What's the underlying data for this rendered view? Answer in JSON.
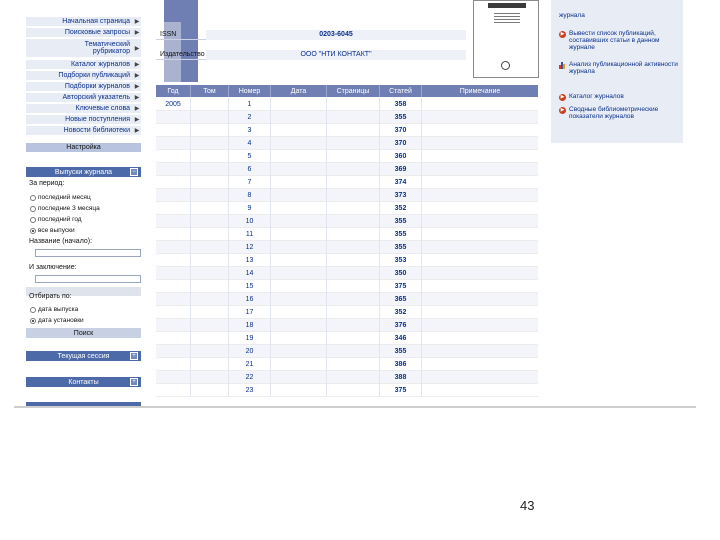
{
  "sidebar": {
    "nav": [
      {
        "label": "Начальная страница"
      },
      {
        "label": "Поисковые запросы"
      },
      {
        "label": "Тематический рубрикатор",
        "line1": "Тематический",
        "line2": "рубрикатор"
      },
      {
        "label": "Каталог журналов"
      },
      {
        "label": "Подборки публикаций"
      },
      {
        "label": "Подборки журналов"
      },
      {
        "label": "Авторский указатель"
      },
      {
        "label": "Ключевые слова"
      },
      {
        "label": "Новые поступления"
      },
      {
        "label": "Новости библиотеки"
      },
      {
        "label": "Настройка"
      }
    ],
    "issues_panel": {
      "title": "Выпуски журнала",
      "period_label": "За период:",
      "period_options": [
        "последний месяц",
        "последние 3 месяца",
        "последний год",
        "все выпуски"
      ],
      "period_selected": 3,
      "title_start_label": "Название (начало):",
      "title_contains_label": "И заключение:",
      "sort_label": "Отбирать по:",
      "sort_options": [
        "дата выпуска",
        "дата установки"
      ],
      "sort_selected": 1,
      "search_label": "Поиск"
    },
    "session_panel": {
      "title": "Текущая сессия"
    },
    "contacts_panel": {
      "title": "Контакты"
    }
  },
  "journal_info": {
    "issn_label": "ISSN",
    "issn_value": "0203-6045",
    "publisher_label": "Издательство",
    "publisher_value": "ООО \"НТИ КОНТАКТ\""
  },
  "right_panel": {
    "items": [
      {
        "text": "журнала",
        "icon": "arrow-circle-icon"
      },
      {
        "text": "Вывести список публикаций, составивших статьи в данном журнале",
        "icon": "arrow-circle-icon"
      },
      {
        "text": "Анализ публикационной активности журнала",
        "icon": "bar-chart-icon"
      },
      {
        "text": "Каталог журналов",
        "icon": "arrow-circle-icon"
      },
      {
        "text": "Сводные библиометрические показатели журналов",
        "icon": "arrow-circle-icon"
      }
    ]
  },
  "table": {
    "headers": [
      "Год",
      "Том",
      "Номер",
      "Дата",
      "Страницы",
      "Статей",
      "Примечание"
    ],
    "year": "2005",
    "rows": [
      {
        "num": "1",
        "articles": "358"
      },
      {
        "num": "2",
        "articles": "355"
      },
      {
        "num": "3",
        "articles": "370"
      },
      {
        "num": "4",
        "articles": "370"
      },
      {
        "num": "5",
        "articles": "360"
      },
      {
        "num": "6",
        "articles": "369"
      },
      {
        "num": "7",
        "articles": "374"
      },
      {
        "num": "8",
        "articles": "373"
      },
      {
        "num": "9",
        "articles": "352"
      },
      {
        "num": "10",
        "articles": "355"
      },
      {
        "num": "11",
        "articles": "355"
      },
      {
        "num": "12",
        "articles": "355"
      },
      {
        "num": "13",
        "articles": "353"
      },
      {
        "num": "14",
        "articles": "350"
      },
      {
        "num": "15",
        "articles": "375"
      },
      {
        "num": "16",
        "articles": "365"
      },
      {
        "num": "17",
        "articles": "352"
      },
      {
        "num": "18",
        "articles": "376"
      },
      {
        "num": "19",
        "articles": "346"
      },
      {
        "num": "20",
        "articles": "355"
      },
      {
        "num": "21",
        "articles": "386"
      },
      {
        "num": "22",
        "articles": "388"
      },
      {
        "num": "23",
        "articles": "375"
      }
    ]
  },
  "slide": {
    "page_number": "43"
  }
}
